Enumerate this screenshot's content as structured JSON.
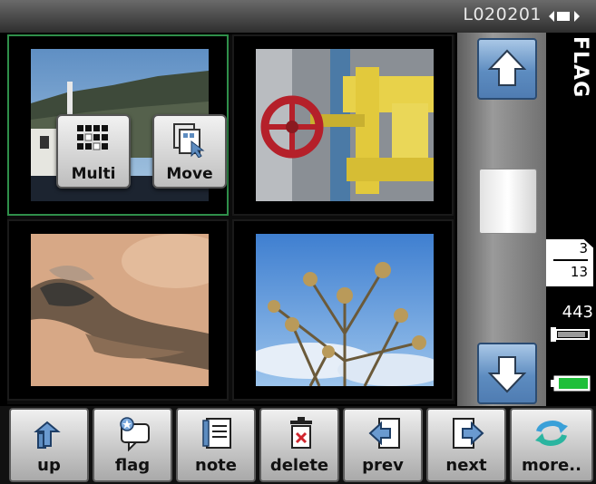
{
  "status_bar": {
    "file_id": "L020201",
    "signal_icon": "signal-icon"
  },
  "thumbnails": [
    {
      "subject": "village-hillside",
      "selected": true
    },
    {
      "subject": "yellow-valve-pipes",
      "selected": false
    },
    {
      "subject": "bird-on-sand",
      "selected": false
    },
    {
      "subject": "dry-plants-sky",
      "selected": false
    }
  ],
  "overlay_menu": {
    "multi_label": "Multi",
    "move_label": "Move",
    "multi_icon": "grid-dots-icon",
    "move_icon": "move-cursor-icon"
  },
  "scroll": {
    "up_icon": "arrow-up-icon",
    "down_icon": "arrow-down-icon"
  },
  "side_status": {
    "mode_label": "FLAG",
    "current_page": "3",
    "total_pages": "13",
    "shots_remaining": "443",
    "memory_icon": "memory-card-icon",
    "battery_icon": "battery-icon",
    "battery_color": "#1fbf3a"
  },
  "toolbar": {
    "buttons": [
      {
        "label": "up",
        "icon": "up-folder-icon"
      },
      {
        "label": "flag",
        "icon": "flag-icon"
      },
      {
        "label": "note",
        "icon": "note-icon"
      },
      {
        "label": "delete",
        "icon": "trash-icon"
      },
      {
        "label": "prev",
        "icon": "prev-icon"
      },
      {
        "label": "next",
        "icon": "next-icon"
      },
      {
        "label": "more..",
        "icon": "refresh-icon"
      }
    ]
  },
  "colors": {
    "accent_blue": "#5d8cc0",
    "selection_green": "#2f8f4a"
  }
}
